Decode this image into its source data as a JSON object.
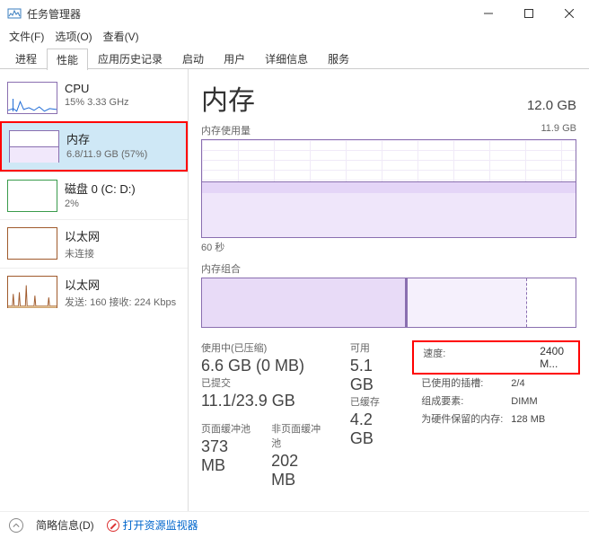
{
  "window": {
    "title": "任务管理器"
  },
  "menu": {
    "file": "文件(F)",
    "options": "选项(O)",
    "view": "查看(V)"
  },
  "tabs": [
    "进程",
    "性能",
    "应用历史记录",
    "启动",
    "用户",
    "详细信息",
    "服务"
  ],
  "active_tab": "性能",
  "sidebar": {
    "items": [
      {
        "title": "CPU",
        "subtitle": "15% 3.33 GHz",
        "kind": "cpu"
      },
      {
        "title": "内存",
        "subtitle": "6.8/11.9 GB (57%)",
        "kind": "mem",
        "selected": true
      },
      {
        "title": "磁盘 0 (C: D:)",
        "subtitle": "2%",
        "kind": "disk"
      },
      {
        "title": "以太网",
        "subtitle": "未连接",
        "kind": "eth1"
      },
      {
        "title": "以太网",
        "subtitle": "发送: 160 接收: 224 Kbps",
        "kind": "eth2"
      }
    ]
  },
  "main": {
    "title": "内存",
    "capacity": "12.0 GB",
    "usage_label": "内存使用量",
    "usage_max": "11.9 GB",
    "x_axis": "60 秒",
    "comp_label": "内存组合"
  },
  "stats": {
    "inuse_label": "使用中(已压缩)",
    "inuse_value": "6.6 GB (0 MB)",
    "avail_label": "可用",
    "avail_value": "5.1 GB",
    "commit_label": "已提交",
    "commit_value": "11.1/23.9 GB",
    "cached_label": "已缓存",
    "cached_value": "4.2 GB",
    "paged_label": "页面缓冲池",
    "paged_value": "373 MB",
    "nonpaged_label": "非页面缓冲池",
    "nonpaged_value": "202 MB"
  },
  "spec": {
    "speed_label": "速度:",
    "speed_value": "2400 M...",
    "slots_label": "已使用的插槽:",
    "slots_value": "2/4",
    "form_label": "组成要素:",
    "form_value": "DIMM",
    "reserved_label": "为硬件保留的内存:",
    "reserved_value": "128 MB"
  },
  "footer": {
    "simple": "简略信息(D)",
    "resmon": "打开资源监视器"
  },
  "chart_data": {
    "type": "area",
    "title": "内存使用量",
    "ylabel": "GB",
    "ylim": [
      0,
      11.9
    ],
    "xlabel": "60 秒",
    "series": [
      {
        "name": "内存",
        "values": [
          6.8,
          6.8,
          6.8,
          6.8,
          6.8,
          6.8,
          6.8,
          6.8,
          6.8,
          6.8
        ]
      }
    ]
  }
}
